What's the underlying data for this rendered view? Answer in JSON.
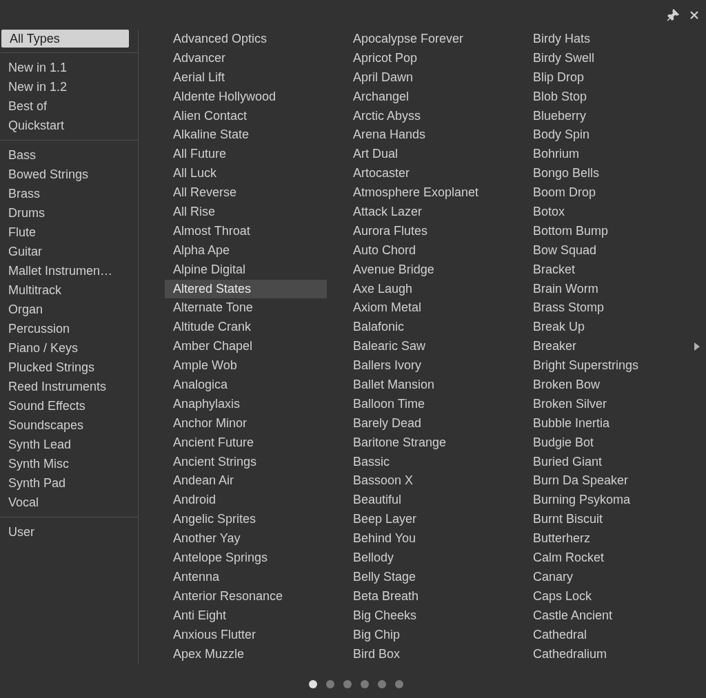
{
  "sidebar": {
    "groups": [
      [
        {
          "label": "All Types",
          "selected": true
        }
      ],
      [
        {
          "label": "New in 1.1",
          "selected": false
        },
        {
          "label": "New in 1.2",
          "selected": false
        },
        {
          "label": "Best of",
          "selected": false
        },
        {
          "label": "Quickstart",
          "selected": false
        }
      ],
      [
        {
          "label": "Bass",
          "selected": false
        },
        {
          "label": "Bowed Strings",
          "selected": false
        },
        {
          "label": "Brass",
          "selected": false
        },
        {
          "label": "Drums",
          "selected": false
        },
        {
          "label": "Flute",
          "selected": false
        },
        {
          "label": "Guitar",
          "selected": false
        },
        {
          "label": "Mallet Instrumen…",
          "selected": false
        },
        {
          "label": "Multitrack",
          "selected": false
        },
        {
          "label": "Organ",
          "selected": false
        },
        {
          "label": "Percussion",
          "selected": false
        },
        {
          "label": "Piano / Keys",
          "selected": false
        },
        {
          "label": "Plucked Strings",
          "selected": false
        },
        {
          "label": "Reed Instruments",
          "selected": false
        },
        {
          "label": "Sound Effects",
          "selected": false
        },
        {
          "label": "Soundscapes",
          "selected": false
        },
        {
          "label": "Synth Lead",
          "selected": false
        },
        {
          "label": "Synth Misc",
          "selected": false
        },
        {
          "label": "Synth Pad",
          "selected": false
        },
        {
          "label": "Vocal",
          "selected": false
        }
      ],
      [
        {
          "label": "User",
          "selected": false
        }
      ]
    ]
  },
  "presets": {
    "columns": [
      [
        {
          "label": "Advanced Optics",
          "selected": false
        },
        {
          "label": "Advancer",
          "selected": false
        },
        {
          "label": "Aerial Lift",
          "selected": false
        },
        {
          "label": "Aldente Hollywood",
          "selected": false
        },
        {
          "label": "Alien Contact",
          "selected": false
        },
        {
          "label": "Alkaline State",
          "selected": false
        },
        {
          "label": "All Future",
          "selected": false
        },
        {
          "label": "All Luck",
          "selected": false
        },
        {
          "label": "All Reverse",
          "selected": false
        },
        {
          "label": "All Rise",
          "selected": false
        },
        {
          "label": "Almost Throat",
          "selected": false
        },
        {
          "label": "Alpha Ape",
          "selected": false
        },
        {
          "label": "Alpine Digital",
          "selected": false
        },
        {
          "label": "Altered States",
          "selected": true
        },
        {
          "label": "Alternate Tone",
          "selected": false
        },
        {
          "label": "Altitude Crank",
          "selected": false
        },
        {
          "label": "Amber Chapel",
          "selected": false
        },
        {
          "label": "Ample Wob",
          "selected": false
        },
        {
          "label": "Analogica",
          "selected": false
        },
        {
          "label": "Anaphylaxis",
          "selected": false
        },
        {
          "label": "Anchor Minor",
          "selected": false
        },
        {
          "label": "Ancient Future",
          "selected": false
        },
        {
          "label": "Ancient Strings",
          "selected": false
        },
        {
          "label": "Andean Air",
          "selected": false
        },
        {
          "label": "Android",
          "selected": false
        },
        {
          "label": "Angelic Sprites",
          "selected": false
        },
        {
          "label": "Another Yay",
          "selected": false
        },
        {
          "label": "Antelope Springs",
          "selected": false
        },
        {
          "label": "Antenna",
          "selected": false
        },
        {
          "label": "Anterior Resonance",
          "selected": false
        },
        {
          "label": "Anti Eight",
          "selected": false
        },
        {
          "label": "Anxious Flutter",
          "selected": false
        },
        {
          "label": "Apex Muzzle",
          "selected": false
        }
      ],
      [
        {
          "label": "Apocalypse Forever",
          "selected": false
        },
        {
          "label": "Apricot Pop",
          "selected": false
        },
        {
          "label": "April Dawn",
          "selected": false
        },
        {
          "label": "Archangel",
          "selected": false
        },
        {
          "label": "Arctic Abyss",
          "selected": false
        },
        {
          "label": "Arena Hands",
          "selected": false
        },
        {
          "label": "Art Dual",
          "selected": false
        },
        {
          "label": "Artocaster",
          "selected": false
        },
        {
          "label": "Atmosphere Exoplanet",
          "selected": false
        },
        {
          "label": "Attack Lazer",
          "selected": false
        },
        {
          "label": "Aurora Flutes",
          "selected": false
        },
        {
          "label": "Auto Chord",
          "selected": false
        },
        {
          "label": "Avenue Bridge",
          "selected": false
        },
        {
          "label": "Axe Laugh",
          "selected": false
        },
        {
          "label": "Axiom Metal",
          "selected": false
        },
        {
          "label": "Balafonic",
          "selected": false
        },
        {
          "label": "Balearic Saw",
          "selected": false
        },
        {
          "label": "Ballers Ivory",
          "selected": false
        },
        {
          "label": "Ballet Mansion",
          "selected": false
        },
        {
          "label": "Balloon Time",
          "selected": false
        },
        {
          "label": "Barely Dead",
          "selected": false
        },
        {
          "label": "Baritone Strange",
          "selected": false
        },
        {
          "label": "Bassic",
          "selected": false
        },
        {
          "label": "Bassoon X",
          "selected": false
        },
        {
          "label": "Beautiful",
          "selected": false
        },
        {
          "label": "Beep Layer",
          "selected": false
        },
        {
          "label": "Behind You",
          "selected": false
        },
        {
          "label": "Bellody",
          "selected": false
        },
        {
          "label": "Belly Stage",
          "selected": false
        },
        {
          "label": "Beta Breath",
          "selected": false
        },
        {
          "label": "Big Cheeks",
          "selected": false
        },
        {
          "label": "Big Chip",
          "selected": false
        },
        {
          "label": "Bird Box",
          "selected": false
        }
      ],
      [
        {
          "label": "Birdy Hats",
          "selected": false
        },
        {
          "label": "Birdy Swell",
          "selected": false
        },
        {
          "label": "Blip Drop",
          "selected": false
        },
        {
          "label": "Blob Stop",
          "selected": false
        },
        {
          "label": "Blueberry",
          "selected": false
        },
        {
          "label": "Body Spin",
          "selected": false
        },
        {
          "label": "Bohrium",
          "selected": false
        },
        {
          "label": "Bongo Bells",
          "selected": false
        },
        {
          "label": "Boom Drop",
          "selected": false
        },
        {
          "label": "Botox",
          "selected": false
        },
        {
          "label": "Bottom Bump",
          "selected": false
        },
        {
          "label": "Bow Squad",
          "selected": false
        },
        {
          "label": "Bracket",
          "selected": false
        },
        {
          "label": "Brain Worm",
          "selected": false
        },
        {
          "label": "Brass Stomp",
          "selected": false
        },
        {
          "label": "Break Up",
          "selected": false
        },
        {
          "label": "Breaker",
          "selected": false
        },
        {
          "label": "Bright Superstrings",
          "selected": false
        },
        {
          "label": "Broken Bow",
          "selected": false
        },
        {
          "label": "Broken Silver",
          "selected": false
        },
        {
          "label": "Bubble Inertia",
          "selected": false
        },
        {
          "label": "Budgie Bot",
          "selected": false
        },
        {
          "label": "Buried Giant",
          "selected": false
        },
        {
          "label": "Burn Da Speaker",
          "selected": false
        },
        {
          "label": "Burning Psykoma",
          "selected": false
        },
        {
          "label": "Burnt Biscuit",
          "selected": false
        },
        {
          "label": "Butterherz",
          "selected": false
        },
        {
          "label": "Calm Rocket",
          "selected": false
        },
        {
          "label": "Canary",
          "selected": false
        },
        {
          "label": "Caps Lock",
          "selected": false
        },
        {
          "label": "Castle Ancient",
          "selected": false
        },
        {
          "label": "Cathedral",
          "selected": false
        },
        {
          "label": "Cathedralium",
          "selected": false
        }
      ]
    ]
  },
  "pager": [
    {
      "selected": true
    },
    {
      "selected": false
    },
    {
      "selected": false
    },
    {
      "selected": false
    },
    {
      "selected": false
    },
    {
      "selected": false
    }
  ]
}
